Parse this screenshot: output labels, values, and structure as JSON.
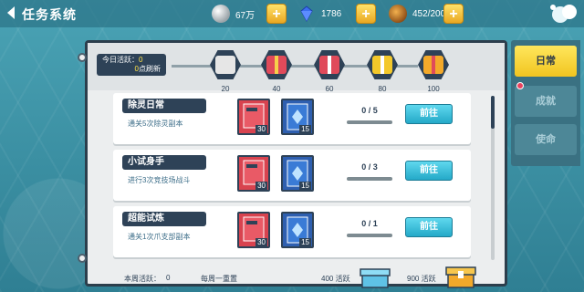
{
  "header": {
    "title": "任务系统",
    "resources": [
      {
        "icon": "silver-coin-icon",
        "value": "67万"
      },
      {
        "icon": "blue-diamond-icon",
        "value": "1786"
      },
      {
        "icon": "stamina-icon",
        "value": "452/200"
      }
    ],
    "plus_label": "+"
  },
  "activity": {
    "label": "今日活跃：",
    "value": "0",
    "refresh_value": "0",
    "refresh_text": "点刷新",
    "milestones": [
      {
        "threshold": "20",
        "color": "#e6e6e6"
      },
      {
        "threshold": "40",
        "color": "#e04a5a"
      },
      {
        "threshold": "60",
        "color": "#e04a5a"
      },
      {
        "threshold": "80",
        "color": "#f3c82a"
      },
      {
        "threshold": "100",
        "color": "#f3a92a"
      }
    ]
  },
  "tasks": [
    {
      "name": "除灵日常",
      "desc": "通关5次除灵副本",
      "reward1_count": "30",
      "reward2_count": "15",
      "progress": "0 / 5",
      "button": "前往"
    },
    {
      "name": "小试身手",
      "desc": "进行3次竞技场战斗",
      "reward1_count": "30",
      "reward2_count": "15",
      "progress": "0 / 3",
      "button": "前往"
    },
    {
      "name": "超能试炼",
      "desc": "通关1次爪支部副本",
      "reward1_count": "30",
      "reward2_count": "15",
      "progress": "0 / 1",
      "button": "前往"
    }
  ],
  "footer": {
    "weekly_label": "本周活跃：",
    "weekly_value": "0",
    "weekly_reset": "每周一重置",
    "milestone1": "400 活跃",
    "milestone2": "900 活跃"
  },
  "tabs": [
    {
      "label": "日常",
      "active": true
    },
    {
      "label": "成就",
      "active": false
    },
    {
      "label": "使命",
      "active": false
    }
  ],
  "colors": {
    "accent": "#24a9c8",
    "panel_dark": "#2e4257",
    "tab_active": "#f1c420"
  }
}
